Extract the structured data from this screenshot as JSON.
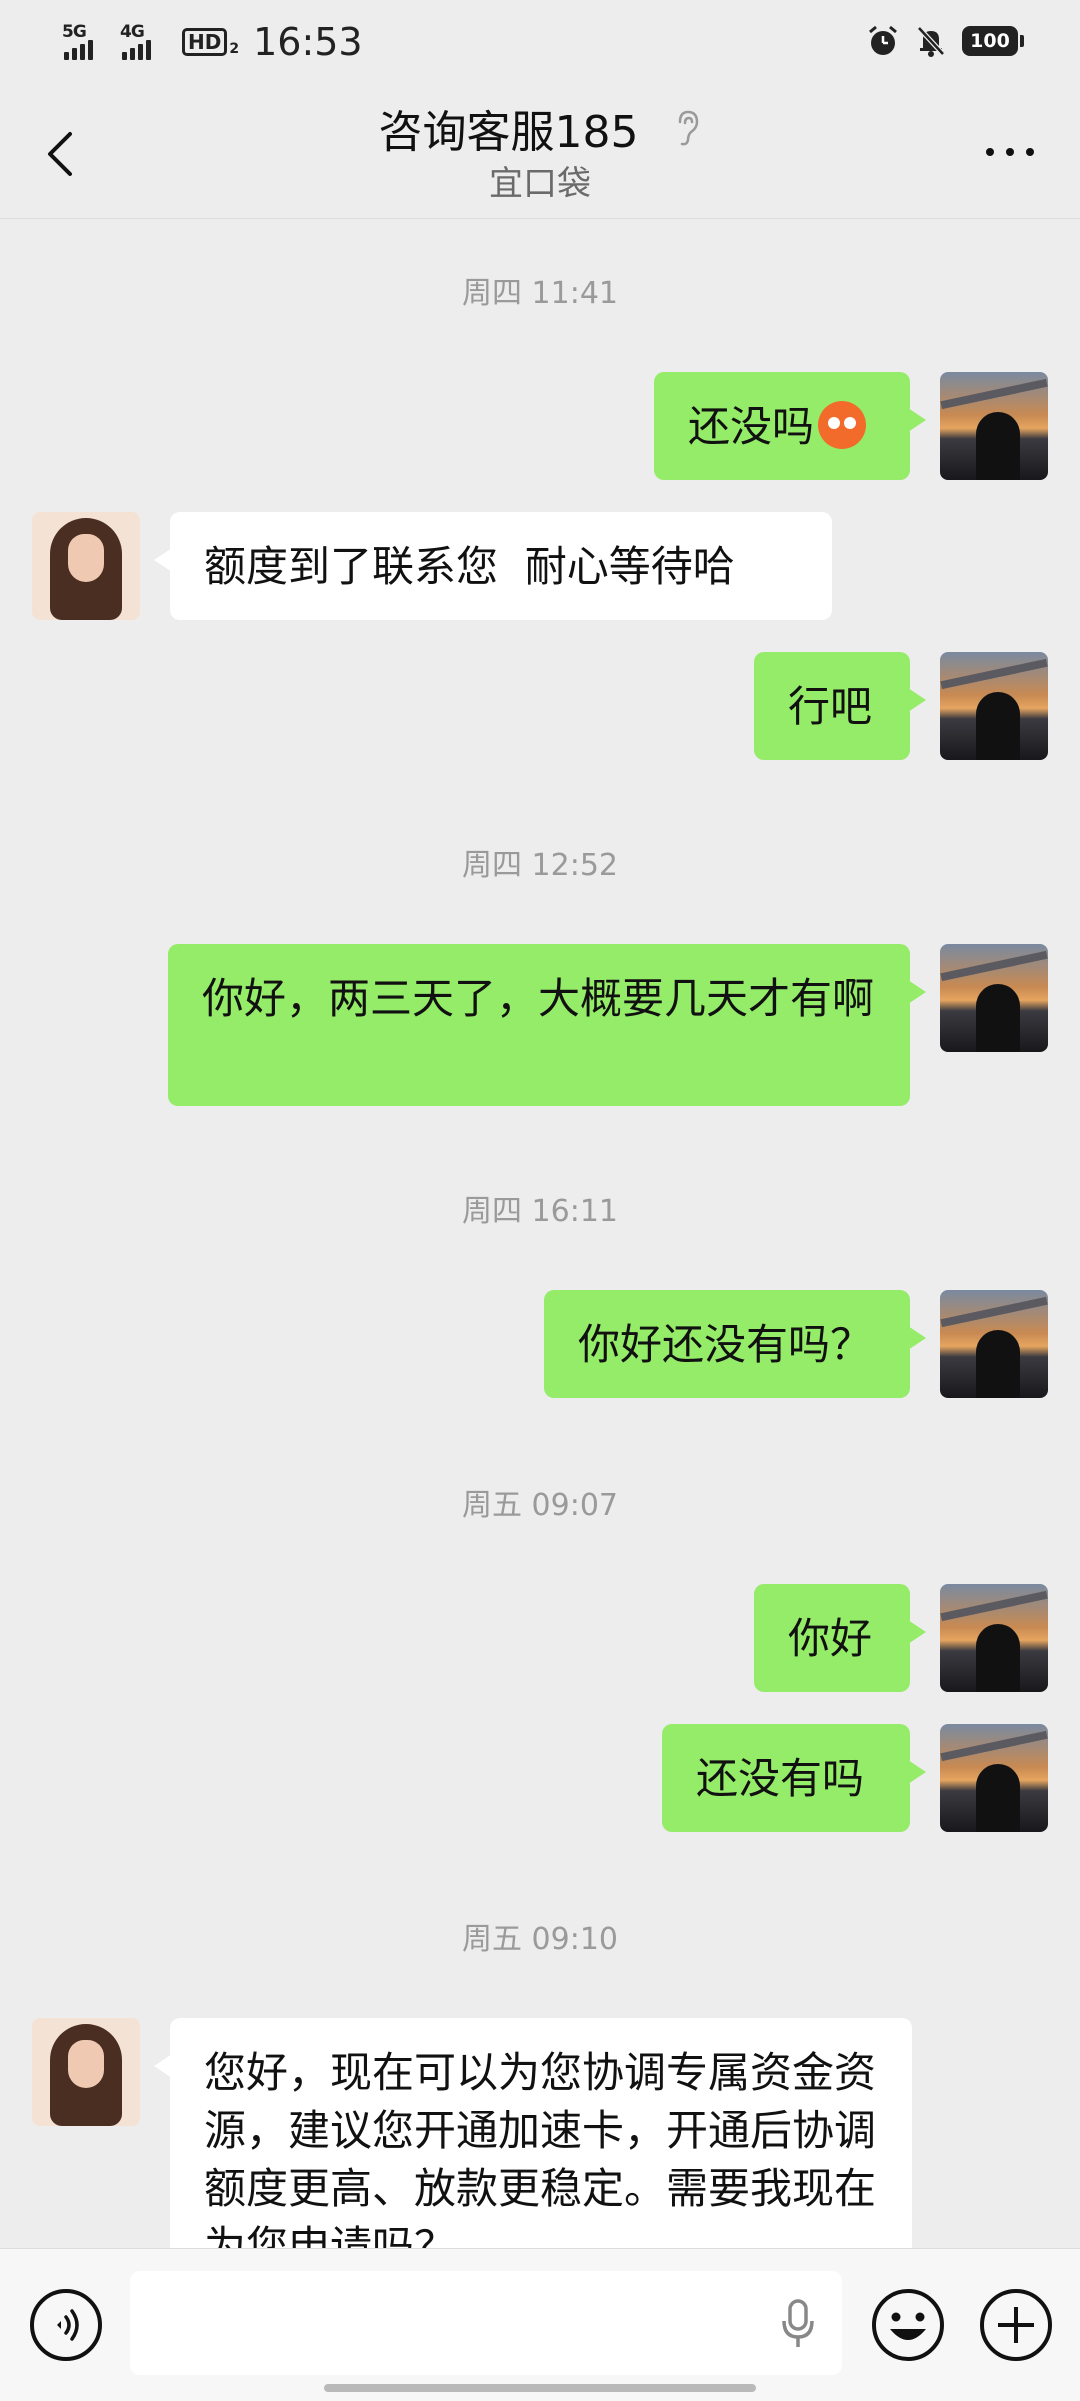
{
  "status_bar": {
    "network1": "5G",
    "network2": "4G",
    "hd_label": "HD",
    "hd_sub": "2",
    "time": "16:53",
    "battery": "100"
  },
  "header": {
    "title": "咨询客服185",
    "subtitle": "宜口袋"
  },
  "messages": [
    {
      "type": "timestamp",
      "text": "周四 11:41"
    },
    {
      "type": "me",
      "text": "还没吗"
    },
    {
      "type": "her",
      "text": "额度到了联系您  耐心等待哈"
    },
    {
      "type": "me",
      "text": "行吧"
    },
    {
      "type": "timestamp",
      "text": "周四 12:52"
    },
    {
      "type": "me",
      "text": "你好，两三天了，大概要几天才有啊"
    },
    {
      "type": "timestamp",
      "text": "周四 16:11"
    },
    {
      "type": "me",
      "text": "你好还没有吗？"
    },
    {
      "type": "timestamp",
      "text": "周五 09:07"
    },
    {
      "type": "me",
      "text": "你好"
    },
    {
      "type": "me",
      "text": "还没有吗"
    },
    {
      "type": "timestamp",
      "text": "周五 09:10"
    },
    {
      "type": "her",
      "text": "您好，现在可以为您协调专属资金资源，建议您开通加速卡，开通后协调额度更高、放款更稳定。需要我现在为您申请吗？"
    }
  ],
  "icons": {
    "back": "back-arrow-icon",
    "ear": "ear-icon",
    "more": "more-icon",
    "voice": "voice-icon",
    "mic": "mic-icon",
    "emoji": "emoji-icon",
    "plus": "plus-icon"
  },
  "colors": {
    "background": "#ededed",
    "my_bubble": "#95ec69",
    "their_bubble": "#ffffff",
    "timestamp": "#9a9a9a"
  }
}
